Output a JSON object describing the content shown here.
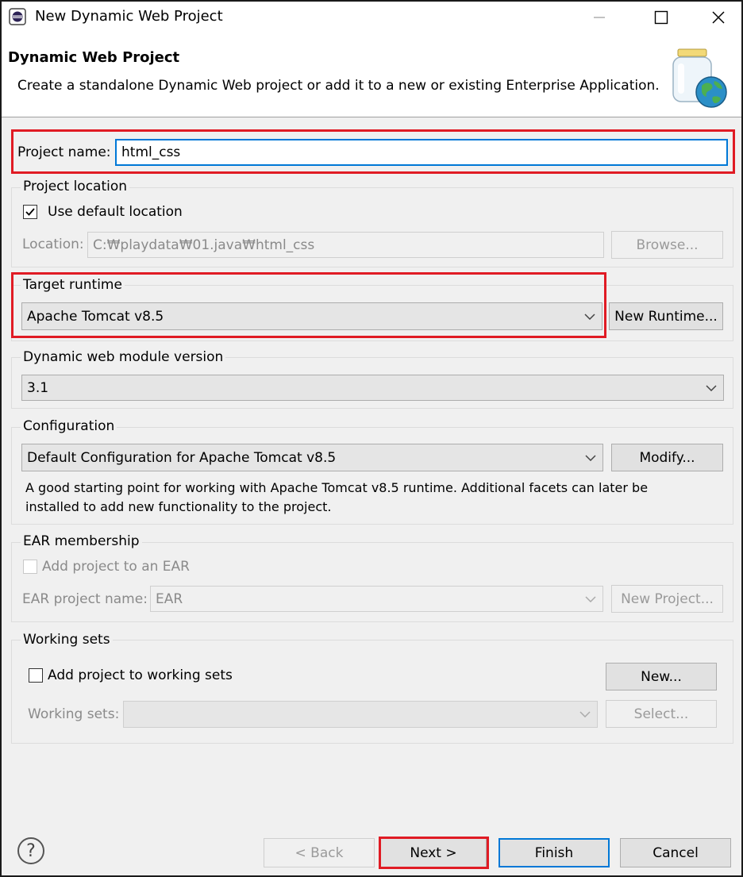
{
  "window": {
    "title": "New Dynamic Web Project",
    "controls": [
      "minimize",
      "maximize",
      "close"
    ]
  },
  "header": {
    "title": "Dynamic Web Project",
    "description": "Create a standalone Dynamic Web project or add it to a new or existing Enterprise Application."
  },
  "project_name": {
    "label": "Project name:",
    "value": "html_css"
  },
  "project_location": {
    "group_label": "Project location",
    "use_default_label": "Use default location",
    "use_default_checked": true,
    "location_label": "Location:",
    "location_value": "C:₩playdata₩01.java₩html_css",
    "browse_label": "Browse..."
  },
  "target_runtime": {
    "group_label": "Target runtime",
    "selected": "Apache Tomcat v8.5",
    "new_runtime_label": "New Runtime..."
  },
  "module_version": {
    "group_label": "Dynamic web module version",
    "selected": "3.1"
  },
  "configuration": {
    "group_label": "Configuration",
    "selected": "Default Configuration for Apache Tomcat v8.5",
    "modify_label": "Modify...",
    "description_line1": "A good starting point for working with Apache Tomcat v8.5 runtime. Additional facets can later be",
    "description_line2": "installed to add new functionality to the project."
  },
  "ear": {
    "group_label": "EAR membership",
    "add_label": "Add project to an EAR",
    "name_label": "EAR project name:",
    "name_value": "EAR",
    "new_project_label": "New Project..."
  },
  "working_sets": {
    "group_label": "Working sets",
    "add_label": "Add project to working sets",
    "new_label": "New...",
    "sets_label": "Working sets:",
    "select_label": "Select..."
  },
  "footer": {
    "help_symbol": "?",
    "back_label": "< Back",
    "next_label": "Next >",
    "finish_label": "Finish",
    "cancel_label": "Cancel"
  },
  "colors": {
    "highlight": "#e01b24",
    "focus": "#0078d7"
  }
}
